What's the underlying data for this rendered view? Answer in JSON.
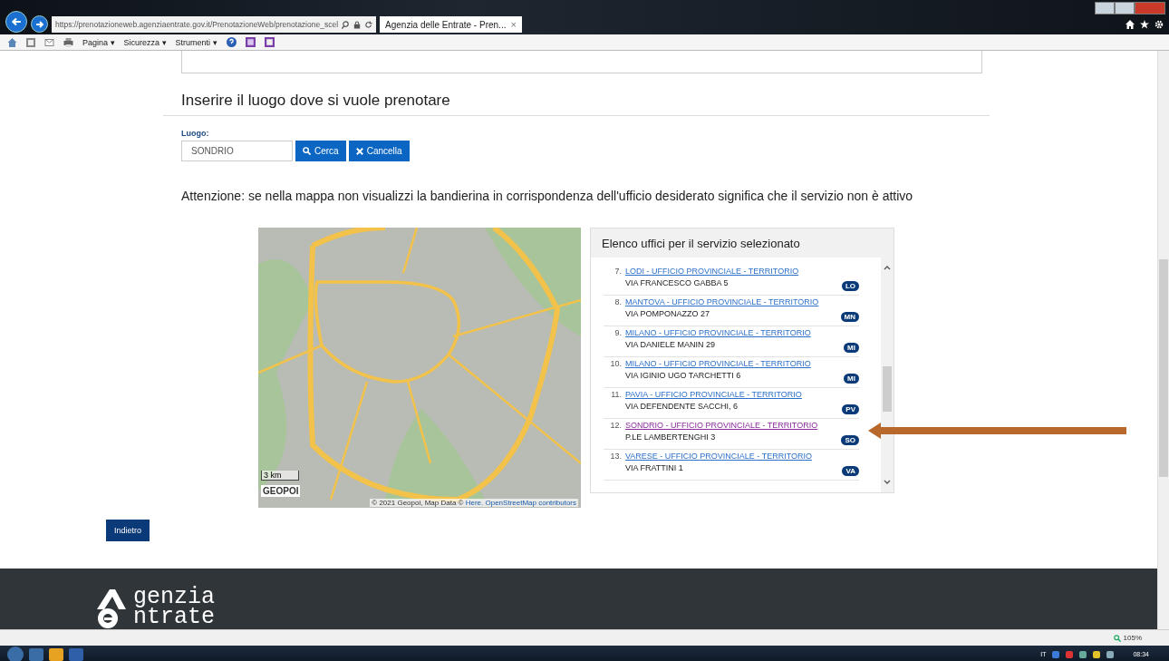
{
  "browser": {
    "address": "https://prenotazioneweb.agenziaentrate.gov.it/PrenotazioneWeb/prenotazione_scel",
    "tab_title": "Agenzia delle Entrate - Pren...",
    "tab_close": "×",
    "command_bar": [
      "Pagina ▾",
      "Sicurezza ▾",
      "Strumenti ▾"
    ],
    "zoom": "105%"
  },
  "section": {
    "title": "Inserire il luogo dove si vuole prenotare",
    "field_label": "Luogo:",
    "field_value": "SONDRIO",
    "buttons": [
      {
        "kind": "search",
        "label": "Cerca"
      },
      {
        "kind": "clear",
        "label": "Cancella"
      }
    ]
  },
  "notice": "Attenzione: se nella mappa non visualizzi la bandierina in corrispondenza dell'ufficio desiderato significa che il servizio non è attivo",
  "map": {
    "scale": "3 km",
    "brand": "GEOPOI",
    "attribution": "© 2021 Geopoi, Map Data ©",
    "links": [
      "Here.",
      "OpenStreetMap contributors"
    ]
  },
  "office_list": {
    "title": "Elenco uffici per il servizio selezionato",
    "items": [
      {
        "number": "7.",
        "name": "LODI - UFFICIO PROVINCIALE - TERRITORIO",
        "address": "VIA FRANCESCO GABBA 5",
        "badge": "LO",
        "visited": false
      },
      {
        "number": "8.",
        "name": "MANTOVA - UFFICIO PROVINCIALE - TERRITORIO",
        "address": "VIA POMPONAZZO 27",
        "badge": "MN",
        "visited": false
      },
      {
        "number": "9.",
        "name": "MILANO - UFFICIO PROVINCIALE - TERRITORIO",
        "address": "VIA DANIELE MANIN 29",
        "badge": "MI",
        "visited": false
      },
      {
        "number": "10.",
        "name": "MILANO - UFFICIO PROVINCIALE - TERRITORIO",
        "address": "VIA IGINIO UGO TARCHETTI 6",
        "badge": "MI",
        "visited": false
      },
      {
        "number": "11.",
        "name": "PAVIA - UFFICIO PROVINCIALE - TERRITORIO",
        "address": "VIA DEFENDENTE SACCHI, 6",
        "badge": "PV",
        "visited": false
      },
      {
        "number": "12.",
        "name": "SONDRIO - UFFICIO PROVINCIALE - TERRITORIO",
        "address": "P.LE LAMBERTENGHI 3",
        "badge": "SO",
        "visited": true
      },
      {
        "number": "13.",
        "name": "VARESE - UFFICIO PROVINCIALE - TERRITORIO",
        "address": "VIA FRATTINI 1",
        "badge": "VA",
        "visited": false
      }
    ]
  },
  "back_button": "Indietro",
  "footer": {
    "logo_lines": [
      "genzia",
      "ntrate"
    ]
  },
  "taskbar": {
    "language": "IT",
    "time": "08:34"
  }
}
